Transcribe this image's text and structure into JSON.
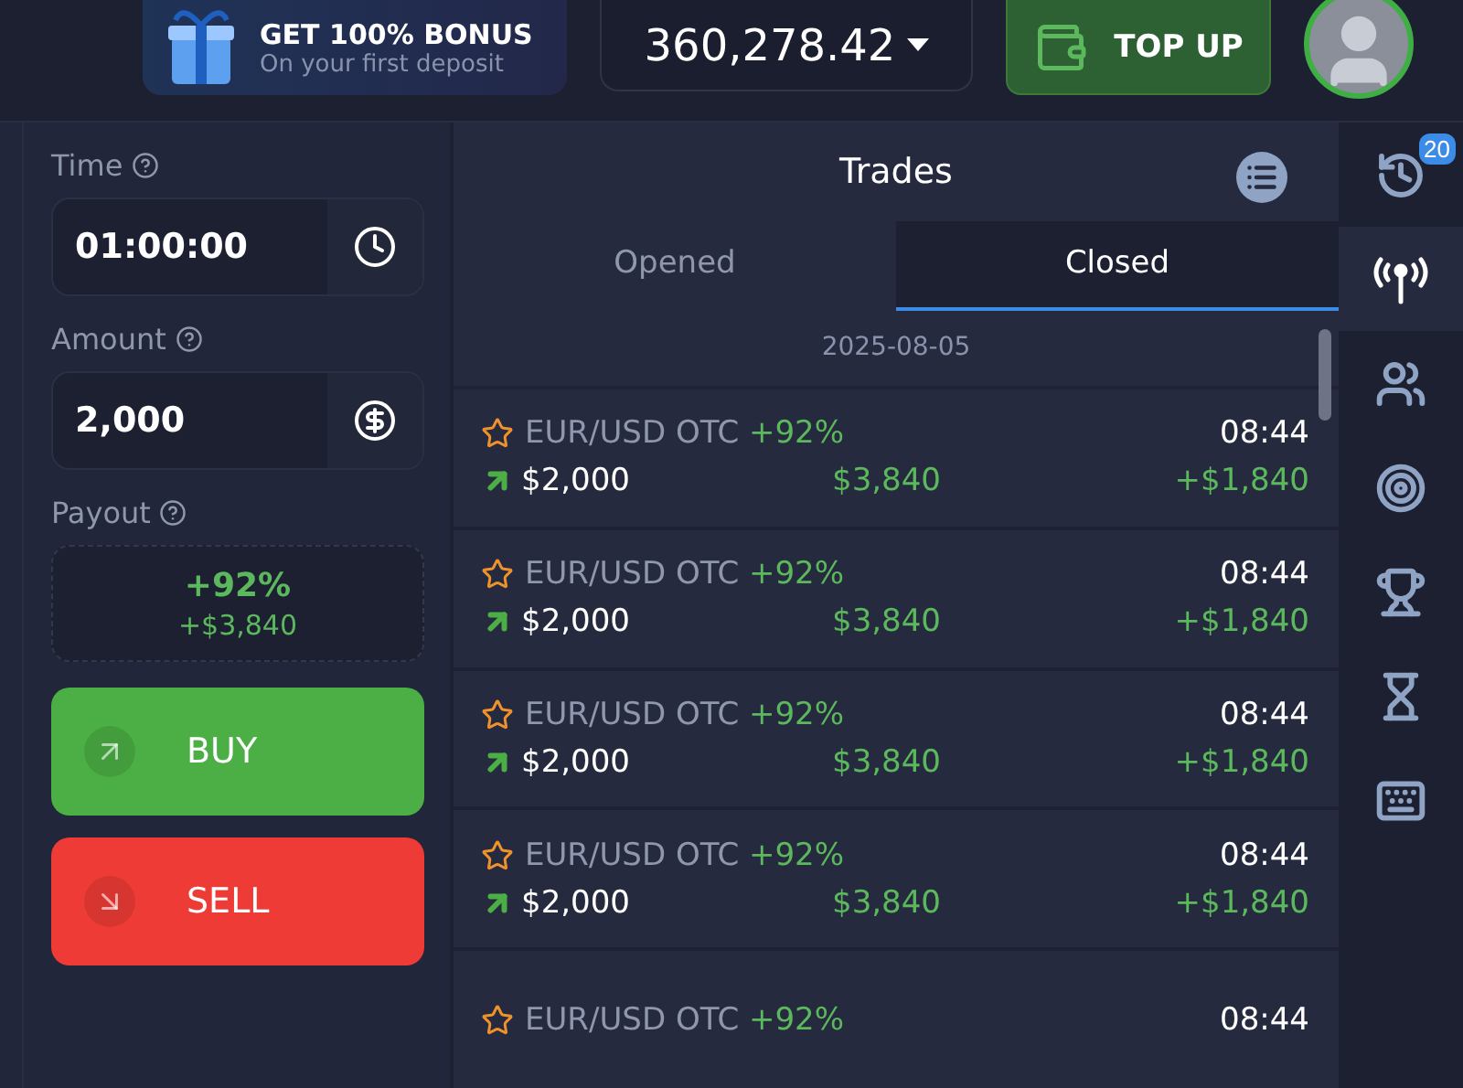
{
  "header": {
    "bonus": {
      "title": "GET 100% BONUS",
      "subtitle": "On your first deposit"
    },
    "balance": "360,278.42",
    "top_up": "TOP UP"
  },
  "order": {
    "fields": [
      {
        "kind": "time",
        "label": "Time",
        "value": "01:00:00"
      },
      {
        "kind": "amount",
        "label": "Amount",
        "value": "2,000"
      }
    ],
    "payout": {
      "label": "Payout",
      "percent": "+92%",
      "amount": "+$3,840"
    },
    "buttons": [
      {
        "kind": "buy",
        "label": "BUY"
      },
      {
        "kind": "sell",
        "label": "SELL"
      }
    ]
  },
  "trades": {
    "title": "Trades",
    "tabs": [
      {
        "label": "Opened",
        "selected": false
      },
      {
        "label": "Closed",
        "selected": true
      }
    ],
    "date": "2025-08-05",
    "rows": [
      {
        "asset": "EUR/USD OTC",
        "payout": "+92%",
        "time": "08:44",
        "amount": "$2,000",
        "result": "$3,840",
        "profit": "+$1,840"
      },
      {
        "asset": "EUR/USD OTC",
        "payout": "+92%",
        "time": "08:44",
        "amount": "$2,000",
        "result": "$3,840",
        "profit": "+$1,840"
      },
      {
        "asset": "EUR/USD OTC",
        "payout": "+92%",
        "time": "08:44",
        "amount": "$2,000",
        "result": "$3,840",
        "profit": "+$1,840"
      },
      {
        "asset": "EUR/USD OTC",
        "payout": "+92%",
        "time": "08:44",
        "amount": "$2,000",
        "result": "$3,840",
        "profit": "+$1,840"
      },
      {
        "asset": "EUR/USD OTC",
        "payout": "+92%",
        "time": "08:44"
      }
    ]
  },
  "sidebar": [
    {
      "kind": "history",
      "badge": "20",
      "selected": false
    },
    {
      "kind": "signals",
      "selected": true
    },
    {
      "kind": "community",
      "selected": false
    },
    {
      "kind": "target",
      "selected": false
    },
    {
      "kind": "trophy",
      "selected": false
    },
    {
      "kind": "hourglass",
      "selected": false
    },
    {
      "kind": "keyboard",
      "selected": false
    }
  ]
}
